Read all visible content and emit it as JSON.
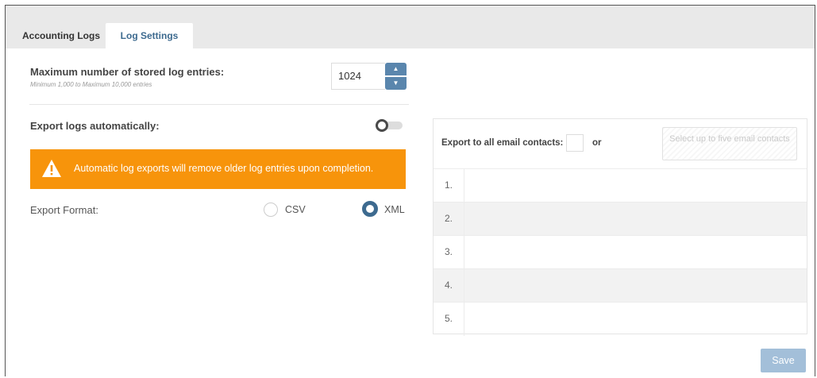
{
  "tabs": [
    {
      "label": "Accounting Logs",
      "active": false
    },
    {
      "label": "Log Settings",
      "active": true
    }
  ],
  "max_entries": {
    "label": "Maximum number of stored log entries:",
    "hint": "Minimum 1,000 to Maximum 10,000 entries",
    "value": "1024"
  },
  "export_auto": {
    "label": "Export logs automatically:",
    "enabled": false
  },
  "warning": {
    "text": "Automatic log exports will remove older log entries upon completion.",
    "color": "#f7940b"
  },
  "export_format": {
    "label": "Export Format:",
    "options": [
      "CSV",
      "XML"
    ],
    "selected": "XML"
  },
  "email": {
    "all_contacts_label": "Export to all email contacts:",
    "or_text": "or",
    "select_button": "Select up to five email contacts",
    "rows": [
      {
        "num": "1.",
        "value": ""
      },
      {
        "num": "2.",
        "value": ""
      },
      {
        "num": "3.",
        "value": ""
      },
      {
        "num": "4.",
        "value": ""
      },
      {
        "num": "5.",
        "value": ""
      }
    ]
  },
  "save_label": "Save",
  "colors": {
    "accent": "#3d6a8f",
    "spinner": "#5a86ad",
    "save_disabled": "#a3bfd9"
  }
}
